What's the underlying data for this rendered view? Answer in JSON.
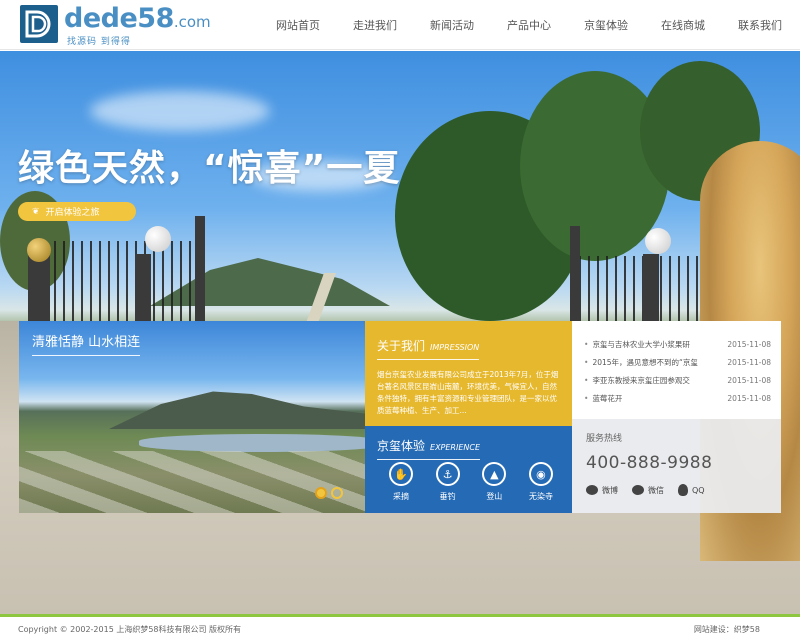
{
  "header": {
    "logo": {
      "word": "dede",
      "number": "58",
      "domain": ".com",
      "slogan": "找源码 到得得"
    },
    "nav": [
      "网站首页",
      "走进我们",
      "新闻活动",
      "产品中心",
      "京玺体验",
      "在线商城",
      "联系我们"
    ]
  },
  "hero": {
    "title": "绿色天然，“惊喜”一夏",
    "button": "开启体验之旅",
    "accent_color": "#f2c53f"
  },
  "photo_panel": {
    "title": "清雅恬静 山水相连"
  },
  "about": {
    "title": "关于我们",
    "title_en": "IMPRESSION",
    "text": "烟台京玺农业发展有限公司成立于2013年7月，位于烟台著名风景区昆嵛山南麓，环境优美，气候宜人，自然条件独特，拥有丰富资源和专业管理团队，是一家以优质蓝莓种植、生产、加工...",
    "bg_color": "#e6b82e"
  },
  "experience": {
    "title": "京玺体验",
    "title_en": "EXPERIENCE",
    "items": [
      {
        "label": "采摘",
        "icon": "hand-icon"
      },
      {
        "label": "垂钓",
        "icon": "fishing-icon"
      },
      {
        "label": "登山",
        "icon": "mountain-icon"
      },
      {
        "label": "无染寺",
        "icon": "eye-icon"
      }
    ],
    "bg_color": "#256ab5"
  },
  "news": [
    {
      "title": "京玺与吉林农业大学小浆果研",
      "date": "2015-11-08"
    },
    {
      "title": "2015年，遇见意想不到的“京玺",
      "date": "2015-11-08"
    },
    {
      "title": "李亚东教授来京玺庄园参观交",
      "date": "2015-11-08"
    },
    {
      "title": "蓝莓花开",
      "date": "2015-11-08"
    }
  ],
  "hotline": {
    "label": "服务热线",
    "phone": "400-888-9988",
    "social": [
      "微博",
      "微信",
      "QQ"
    ]
  },
  "footer": {
    "copyright": "Copyright © 2002-2015 上海织梦58科技有限公司 版权所有",
    "credit": "网站建设：织梦58",
    "border_color": "#8dc63f"
  }
}
